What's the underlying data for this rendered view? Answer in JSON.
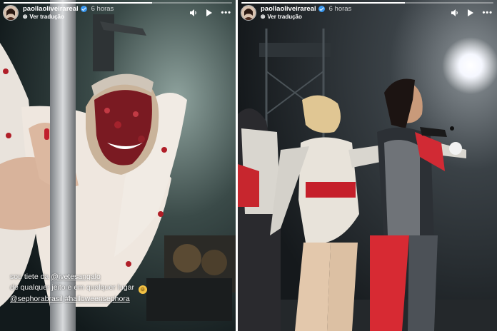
{
  "stories": [
    {
      "username": "paollaoliveirareal",
      "time": "6 horas",
      "translate_label": "Ver tradução",
      "progress": 0.65,
      "caption": {
        "line1_text": "sou tiete da",
        "line1_mention": "@ivetesangalo",
        "line2": "de qualquer jeito e em qualquer lugar",
        "tag1": "@sephorabrasil",
        "tag2": "#halloweensephora"
      }
    },
    {
      "username": "paollaoliveirareal",
      "time": "6 horas",
      "translate_label": "Ver tradução",
      "progress": 0.65
    }
  ],
  "icons": {
    "verified": "verified-badge-icon",
    "translate": "translate-icon",
    "volume": "volume-icon",
    "play": "play-icon",
    "more": "more-options-icon",
    "emoji": "grinning-emoji-icon"
  },
  "colors": {
    "verified_blue": "#3897f0",
    "progress_bg": "rgba(255,255,255,0.35)"
  }
}
